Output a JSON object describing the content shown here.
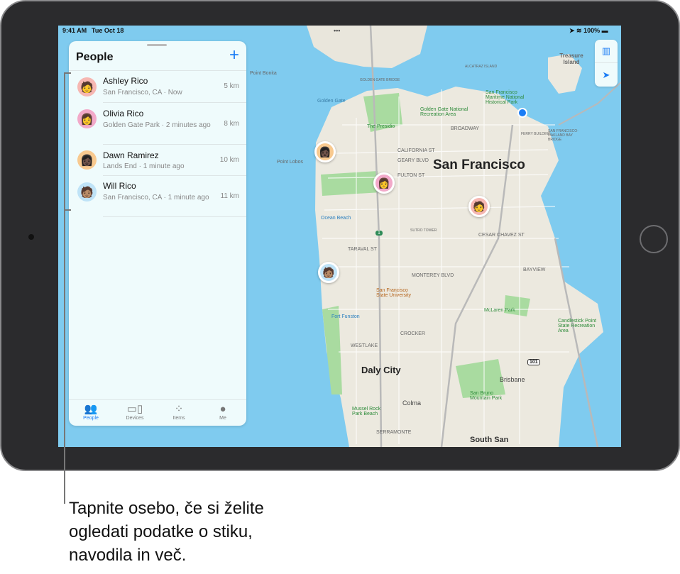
{
  "status_bar": {
    "time": "9:41 AM",
    "date": "Tue Oct 18",
    "battery": "100%",
    "dots": "•••"
  },
  "panel": {
    "title": "People",
    "add_icon": "plus-icon",
    "people": [
      {
        "name": "Ashley Rico",
        "location": "San Francisco, CA · Now",
        "distance": "5 km",
        "avatar": "🧑",
        "color": "#f6b7b2"
      },
      {
        "name": "Olivia Rico",
        "location": "Golden Gate Park · 2 minutes ago",
        "distance": "8 km",
        "avatar": "👩",
        "color": "#f2a9c9"
      },
      {
        "name": "Dawn Ramirez",
        "location": "Lands End · 1 minute ago",
        "distance": "10 km",
        "avatar": "👩🏿",
        "color": "#f8c98f"
      },
      {
        "name": "Will Rico",
        "location": "San Francisco, CA · 1 minute ago",
        "distance": "11 km",
        "avatar": "🧑🏽",
        "color": "#bfe3f7"
      }
    ]
  },
  "tabs": [
    {
      "label": "People",
      "icon": "people-icon",
      "active": true
    },
    {
      "label": "Devices",
      "icon": "devices-icon"
    },
    {
      "label": "Items",
      "icon": "items-icon"
    },
    {
      "label": "Me",
      "icon": "me-icon"
    }
  ],
  "map": {
    "labels": {
      "sf": "San Francisco",
      "daly": "Daly City",
      "treasure": "Treasure Island",
      "bonita": "Point Bonita",
      "lobos": "Point Lobos",
      "ggate": "Golden Gate",
      "ggbridge": "GOLDEN GATE BRIDGE",
      "alcatraz": "ALCATRAZ ISLAND",
      "presidio": "The Presidio",
      "ggnra": "Golden Gate National Recreation Area",
      "maritime": "San Francisco Maritime National Historical Park",
      "ocean": "Ocean Beach",
      "sutro": "SUTRO TOWER",
      "sfsu": "San Francisco State University",
      "funston": "Fort Funston",
      "mclaren": "McLaren Park",
      "candlestick": "Candlestick Point State Recreation Area",
      "brisbane": "Brisbane",
      "colma": "Colma",
      "brunomtn": "San Bruno Mountain Park",
      "mussel": "Mussel Rock Park Beach",
      "serramonte": "SERRAMONTE",
      "westlake": "WESTLAKE",
      "crocker": "CROCKER",
      "bayview": "BAYVIEW",
      "southsf": "South San",
      "broadway": "BROADWAY",
      "california": "CALIFORNIA ST",
      "geary": "GEARY BLVD",
      "fulton": "FULTON ST",
      "taraval": "TARAVAL ST",
      "monterey": "MONTEREY BLVD",
      "cesar": "CESAR CHAVEZ ST",
      "ferry": "FERRY BUILDING",
      "baybridge": "SAN FRANCISCO-OAKLAND BAY BRIDGE",
      "hwy1": "1",
      "hwy101": "101"
    }
  },
  "map_controls": {
    "map_icon": "map-icon",
    "location_icon": "location-arrow-icon"
  },
  "caption": [
    "Tapnite osebo, če si želite",
    "ogledati podatke o stiku,",
    "navodila in več."
  ]
}
